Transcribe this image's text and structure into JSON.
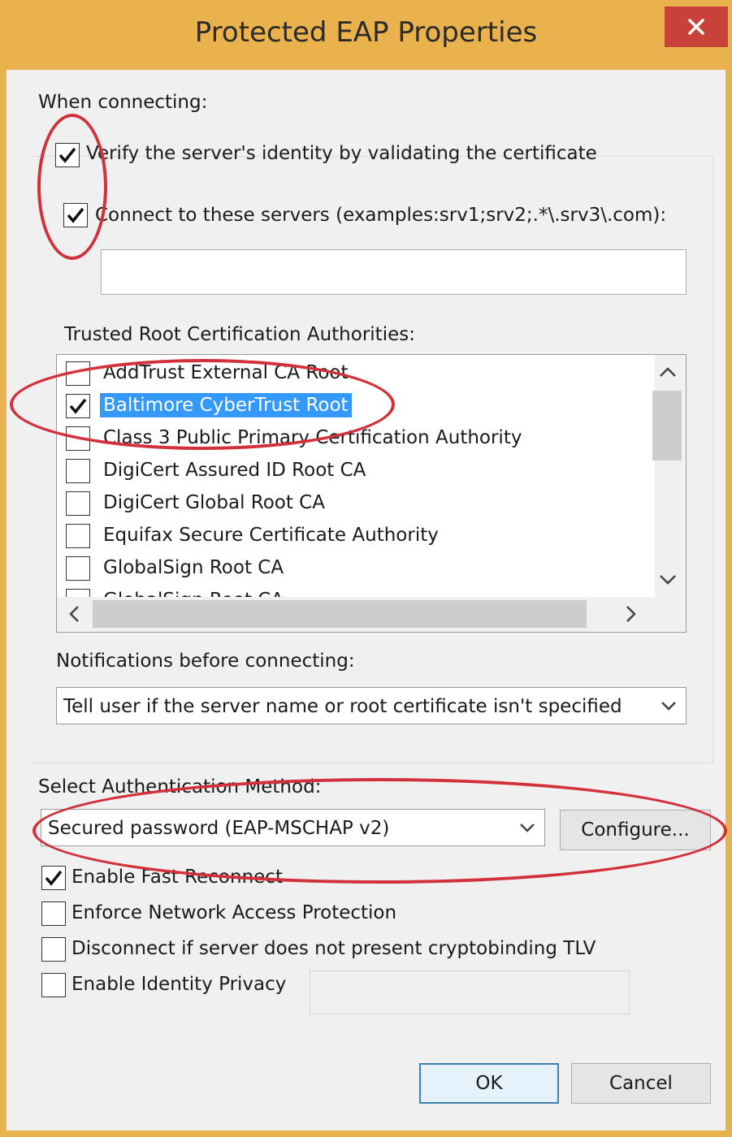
{
  "window": {
    "title": "Protected EAP Properties",
    "close_symbol": "✕"
  },
  "connecting": {
    "heading": "When connecting:",
    "verify": {
      "label": "Verify the server's identity by validating the certificate",
      "checked": true
    },
    "connect_servers": {
      "label": "Connect to these servers (examples:srv1;srv2;.*\\.srv3\\.com):",
      "checked": true,
      "value": ""
    }
  },
  "trusted_roots": {
    "heading": "Trusted Root Certification Authorities:",
    "items": [
      {
        "label": "AddTrust External CA Root",
        "checked": false,
        "selected": false
      },
      {
        "label": "Baltimore CyberTrust Root",
        "checked": true,
        "selected": true
      },
      {
        "label": "Class 3 Public Primary Certification Authority",
        "checked": false,
        "selected": false
      },
      {
        "label": "DigiCert Assured ID Root CA",
        "checked": false,
        "selected": false
      },
      {
        "label": "DigiCert Global Root CA",
        "checked": false,
        "selected": false
      },
      {
        "label": "Equifax Secure Certificate Authority",
        "checked": false,
        "selected": false
      },
      {
        "label": "GlobalSign Root CA",
        "checked": false,
        "selected": false
      },
      {
        "label": "GlobalSign Root CA",
        "checked": false,
        "selected": false
      }
    ]
  },
  "notifications": {
    "heading": "Notifications before connecting:",
    "selected": "Tell user if the server name or root certificate isn't specified"
  },
  "auth_method": {
    "heading": "Select Authentication Method:",
    "selected": "Secured password (EAP-MSCHAP v2)",
    "configure_label": "Configure..."
  },
  "options": [
    {
      "label": "Enable Fast Reconnect",
      "checked": true
    },
    {
      "label": "Enforce Network Access Protection",
      "checked": false
    },
    {
      "label": "Disconnect if server does not present cryptobinding TLV",
      "checked": false
    },
    {
      "label": "Enable Identity Privacy",
      "checked": false
    }
  ],
  "identity_privacy_value": "",
  "buttons": {
    "ok": "OK",
    "cancel": "Cancel"
  },
  "colors": {
    "frame": "#eab24c",
    "close": "#c8423a",
    "selection": "#3399ff",
    "annotation": "#d2313b"
  }
}
